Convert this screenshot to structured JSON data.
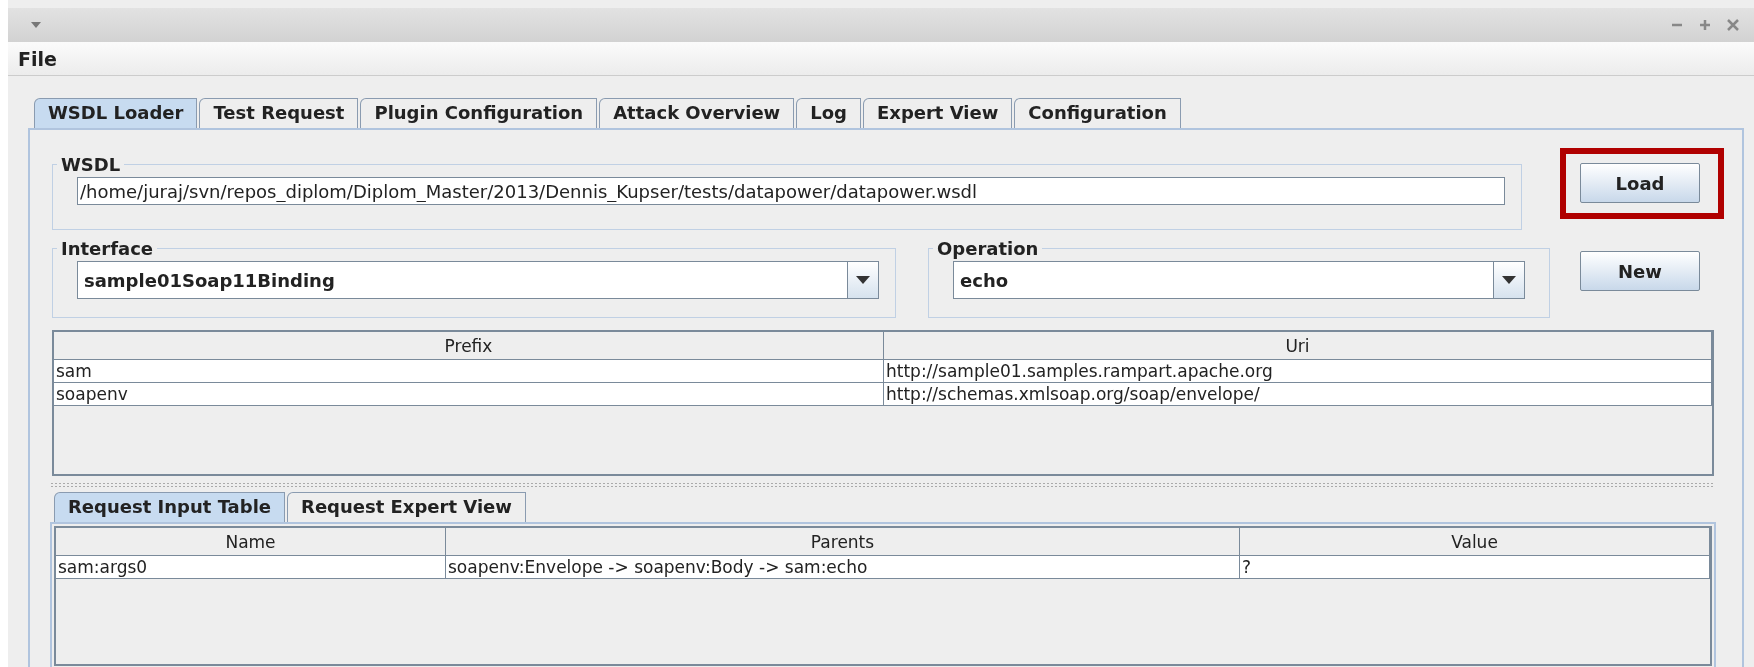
{
  "menu": [
    "File"
  ],
  "tabs": [
    {
      "label": "WSDL Loader",
      "selected": true
    },
    {
      "label": "Test Request",
      "selected": false
    },
    {
      "label": "Plugin Configuration",
      "selected": false
    },
    {
      "label": "Attack Overview",
      "selected": false
    },
    {
      "label": "Log",
      "selected": false
    },
    {
      "label": "Expert View",
      "selected": false
    },
    {
      "label": "Configuration",
      "selected": false
    }
  ],
  "wsdl": {
    "label": "WSDL",
    "value": "/home/juraj/svn/repos_diplom/Diplom_Master/2013/Dennis_Kupser/tests/datapower/datapower.wsdl"
  },
  "load_button": {
    "label": "Load",
    "highlighted": true
  },
  "interface": {
    "label": "Interface",
    "value": "sample01Soap11Binding"
  },
  "operation": {
    "label": "Operation",
    "value": "echo"
  },
  "new_button": {
    "label": "New"
  },
  "namespace_table": {
    "columns": [
      "Prefix",
      "Uri"
    ],
    "rows": [
      [
        "sam",
        "http://sample01.samples.rampart.apache.org"
      ],
      [
        "soapenv",
        "http://schemas.xmlsoap.org/soap/envelope/"
      ]
    ]
  },
  "request_tabs": [
    {
      "label": "Request Input Table",
      "selected": true
    },
    {
      "label": "Request Expert View",
      "selected": false
    }
  ],
  "request_table": {
    "columns": [
      "Name",
      "Parents",
      "Value"
    ],
    "rows": [
      [
        "sam:args0",
        "soapenv:Envelope -> soapenv:Body -> sam:echo",
        "?"
      ]
    ]
  }
}
